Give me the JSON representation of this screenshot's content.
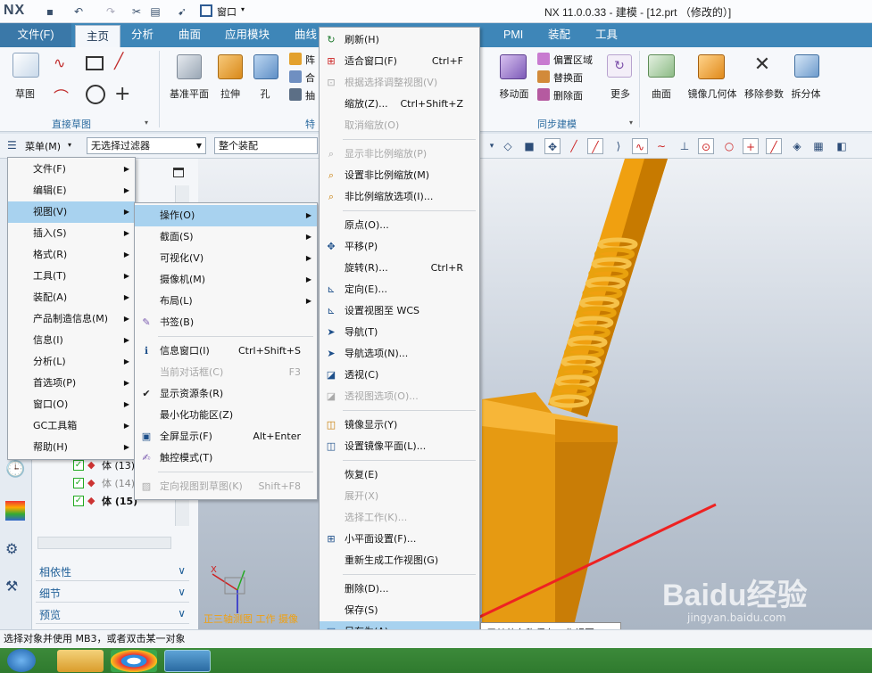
{
  "window": {
    "logo": "NX",
    "window_menu": "窗口",
    "title": "NX 11.0.0.33 - 建模 - [12.prt （修改的）]"
  },
  "ribbon_tabs": [
    "文件(F)",
    "主页",
    "分析",
    "曲面",
    "应用模块",
    "曲线",
    "PMI",
    "装配",
    "工具"
  ],
  "ribbon": {
    "sketch": "草图",
    "direct_sketch_group": "直接草图",
    "datum_plane": "基准平面",
    "extrude": "拉伸",
    "hole": "孔",
    "array_prefix": "阵",
    "combine_prefix": "合",
    "draft_prefix": "抽",
    "feature_group_prefix": "特",
    "move_face": "移动面",
    "offset_region": "偏置区域",
    "replace_face": "替换面",
    "delete_face": "删除面",
    "more": "更多",
    "sync_group": "同步建模",
    "surface": "曲面",
    "mirror_geometry": "镜像几何体",
    "remove_params": "移除参数",
    "split_body": "拆分体"
  },
  "toolbar": {
    "menu_button": "菜单(M)",
    "filter_combo": "无选择过滤器",
    "scope_combo": "整个装配"
  },
  "main_menu": {
    "items": [
      {
        "label": "文件(F)",
        "sub": true
      },
      {
        "label": "编辑(E)",
        "sub": true
      },
      {
        "label": "视图(V)",
        "sub": true
      },
      {
        "label": "插入(S)",
        "sub": true
      },
      {
        "label": "格式(R)",
        "sub": true
      },
      {
        "label": "工具(T)",
        "sub": true
      },
      {
        "label": "装配(A)",
        "sub": true
      },
      {
        "label": "产品制造信息(M)",
        "sub": true
      },
      {
        "label": "信息(I)",
        "sub": true
      },
      {
        "label": "分析(L)",
        "sub": true
      },
      {
        "label": "首选项(P)",
        "sub": true
      },
      {
        "label": "窗口(O)",
        "sub": true
      },
      {
        "label": "GC工具箱",
        "sub": true
      },
      {
        "label": "帮助(H)",
        "sub": true
      }
    ]
  },
  "view_menu": {
    "items": [
      {
        "label": "操作(O)"
      },
      {
        "label": "截面(S)"
      },
      {
        "label": "可视化(V)"
      },
      {
        "label": "摄像机(M)"
      },
      {
        "label": "布局(L)"
      },
      {
        "label": "书签(B)"
      },
      {
        "label": "信息窗口(I)",
        "shortcut": "Ctrl+Shift+S"
      },
      {
        "label": "当前对话框(C)",
        "shortcut": "F3"
      },
      {
        "label": "显示资源条(R)"
      },
      {
        "label": "最小化功能区(Z)"
      },
      {
        "label": "全屏显示(F)",
        "shortcut": "Alt+Enter"
      },
      {
        "label": "触控模式(T)"
      },
      {
        "label": "定向视图到草图(K)",
        "shortcut": "Shift+F8"
      }
    ]
  },
  "operation_menu": {
    "items": [
      {
        "label": "刷新(H)"
      },
      {
        "label": "适合窗口(F)",
        "shortcut": "Ctrl+F"
      },
      {
        "label": "根据选择调整视图(V)"
      },
      {
        "label": "缩放(Z)...",
        "shortcut": "Ctrl+Shift+Z"
      },
      {
        "label": "取消缩放(O)"
      },
      {
        "label": "显示非比例缩放(P)"
      },
      {
        "label": "设置非比例缩放(M)"
      },
      {
        "label": "非比例缩放选项(I)..."
      },
      {
        "label": "原点(O)..."
      },
      {
        "label": "平移(P)"
      },
      {
        "label": "旋转(R)...",
        "shortcut": "Ctrl+R"
      },
      {
        "label": "定向(E)..."
      },
      {
        "label": "设置视图至 WCS"
      },
      {
        "label": "导航(T)"
      },
      {
        "label": "导航选项(N)..."
      },
      {
        "label": "透视(C)"
      },
      {
        "label": "透视图选项(O)..."
      },
      {
        "label": "镜像显示(Y)"
      },
      {
        "label": "设置镜像平面(L)..."
      },
      {
        "label": "恢复(E)"
      },
      {
        "label": "展开(X)"
      },
      {
        "label": "选择工作(K)..."
      },
      {
        "label": "小平面设置(F)..."
      },
      {
        "label": "重新生成工作视图(G)"
      },
      {
        "label": "删除(D)..."
      },
      {
        "label": "保存(S)"
      },
      {
        "label": "另存为(A)..."
      }
    ]
  },
  "tooltip": "用其他名称保存工作视图。",
  "nav_panel": {
    "tree_rows": [
      "体 (13)",
      "体 (14)",
      "体 (15)"
    ],
    "sections": [
      "相依性",
      "细节",
      "预览"
    ]
  },
  "viewport": {
    "view_label": "正三轴测图 工作 摄像"
  },
  "status_text": "选择对象并使用 MB3，或者双击某一对象",
  "watermark": "Baidu经验",
  "watermark_url": "jingyan.baidu.com",
  "colors": {
    "tab_blue": "#3e86b8",
    "highlight": "#a8d2ef",
    "model_orange": "#f0a010"
  }
}
